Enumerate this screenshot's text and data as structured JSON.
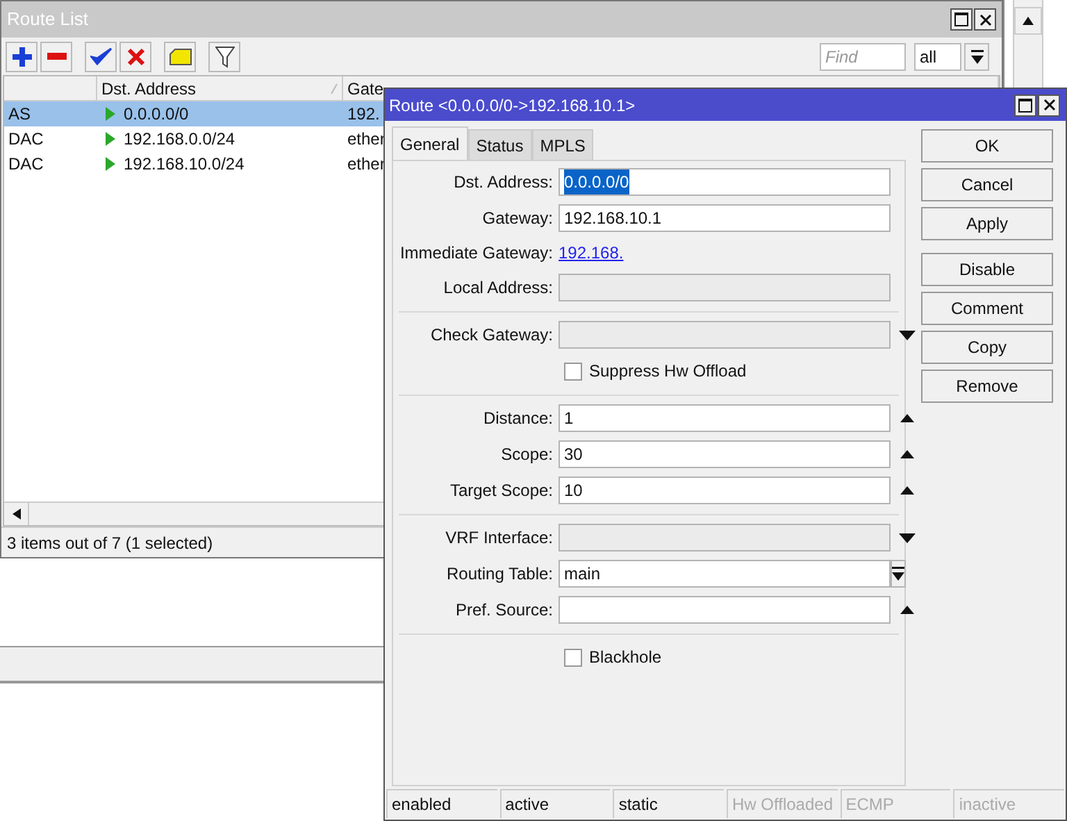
{
  "route_list": {
    "title": "Route List",
    "toolbar": [
      {
        "kind": "add"
      },
      {
        "kind": "remove"
      },
      {
        "kind": "enable"
      },
      {
        "kind": "disable"
      },
      {
        "kind": "comment"
      },
      {
        "kind": "filter"
      }
    ],
    "find": {
      "placeholder": "Find"
    },
    "filter_value": "all",
    "columns": [
      "",
      "Dst. Address",
      "Gate"
    ],
    "rows": [
      {
        "type": "AS",
        "dst": "0.0.0.0/0",
        "gateway": "192.",
        "selected": true
      },
      {
        "type": "DAC",
        "dst": "192.168.0.0/24",
        "gateway": "ether",
        "selected": false
      },
      {
        "type": "DAC",
        "dst": "192.168.10.0/24",
        "gateway": "ether",
        "selected": false
      }
    ],
    "status": "3 items out of 7 (1 selected)"
  },
  "dialog": {
    "title": "Route <0.0.0.0/0->192.168.10.1>",
    "tabs": [
      {
        "label": "General",
        "selected": true
      },
      {
        "label": "Status",
        "selected": false
      },
      {
        "label": "MPLS",
        "selected": false
      }
    ],
    "form": [
      {
        "kind": "text",
        "label": "Dst. Address:",
        "value": "0.0.0.0/0",
        "highlighted": true
      },
      {
        "kind": "text",
        "label": "Gateway:",
        "value": "192.168.10.1",
        "highlighted": false
      },
      {
        "kind": "link",
        "label": "Immediate Gateway:",
        "value": "192.168."
      },
      {
        "kind": "readonly",
        "label": "Local Address:"
      },
      {
        "kind": "divider"
      },
      {
        "kind": "dropdown",
        "label": "Check Gateway:"
      },
      {
        "kind": "checkbox",
        "label": "Suppress Hw Offload",
        "checked": false
      },
      {
        "kind": "divider"
      },
      {
        "kind": "spin",
        "label": "Distance:",
        "value": "1"
      },
      {
        "kind": "spin",
        "label": "Scope:",
        "value": "30"
      },
      {
        "kind": "spin",
        "label": "Target Scope:",
        "value": "10"
      },
      {
        "kind": "divider"
      },
      {
        "kind": "dropdown",
        "label": "VRF Interface:"
      },
      {
        "kind": "combo",
        "label": "Routing Table:",
        "value": "main"
      },
      {
        "kind": "spin",
        "label": "Pref. Source:"
      },
      {
        "kind": "divider"
      },
      {
        "kind": "checkbox",
        "label": "Blackhole",
        "checked": false
      }
    ],
    "buttons": [
      "OK",
      "Cancel",
      "Apply",
      "Disable",
      "Comment",
      "Copy",
      "Remove"
    ],
    "status": [
      {
        "label": "enabled",
        "disabled": false
      },
      {
        "label": "active",
        "disabled": false
      },
      {
        "label": "static",
        "disabled": false
      },
      {
        "label": "Hw Offloaded",
        "disabled": true
      },
      {
        "label": "ECMP",
        "disabled": true
      },
      {
        "label": "inactive",
        "disabled": true
      }
    ]
  }
}
